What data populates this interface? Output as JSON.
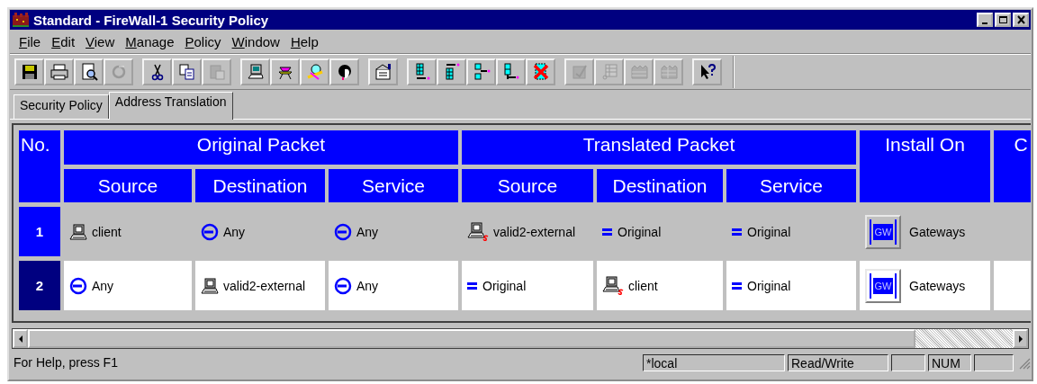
{
  "window": {
    "title": "Standard - FireWall-1 Security Policy"
  },
  "menu": [
    "File",
    "Edit",
    "View",
    "Manage",
    "Policy",
    "Window",
    "Help"
  ],
  "toolbar": [
    {
      "buttons": [
        {
          "disabled": false
        },
        {
          "disabled": false
        },
        {
          "disabled": false
        },
        {
          "disabled": true
        }
      ]
    },
    {
      "buttons": [
        {
          "disabled": false
        },
        {
          "disabled": false
        },
        {
          "disabled": true
        }
      ]
    },
    {
      "buttons": [
        {
          "disabled": false
        },
        {
          "disabled": false
        },
        {
          "disabled": false
        },
        {
          "disabled": false
        }
      ]
    },
    {
      "buttons": [
        {
          "disabled": false
        }
      ]
    },
    {
      "buttons": [
        {
          "disabled": false
        },
        {
          "disabled": false
        },
        {
          "disabled": false
        },
        {
          "disabled": false
        },
        {
          "disabled": false
        }
      ]
    },
    {
      "buttons": [
        {
          "disabled": true
        },
        {
          "disabled": true
        },
        {
          "disabled": true
        },
        {
          "disabled": true
        }
      ]
    },
    {
      "buttons": [
        {
          "disabled": false
        }
      ]
    }
  ],
  "tabs": [
    {
      "label": "Security Policy",
      "selected": false
    },
    {
      "label": "Address Translation",
      "selected": true
    }
  ],
  "table": {
    "headers": [
      {
        "kind": "single",
        "label": "No."
      },
      {
        "kind": "group",
        "label": "Original Packet",
        "columns": [
          "Source",
          "Destination",
          "Service"
        ]
      },
      {
        "kind": "group",
        "label": "Translated Packet",
        "columns": [
          "Source",
          "Destination",
          "Service"
        ]
      },
      {
        "kind": "single",
        "label": "Install On"
      },
      {
        "kind": "single",
        "label": "C"
      }
    ],
    "rows": [
      {
        "number": "1",
        "selected": false,
        "shaded": true,
        "cells": [
          {
            "kind": "host",
            "text": "client"
          },
          {
            "kind": "any",
            "text": "Any"
          },
          {
            "kind": "any",
            "text": "Any"
          },
          {
            "kind": "translated-host",
            "text": "valid2-external"
          },
          {
            "kind": "original",
            "text": "Original"
          },
          {
            "kind": "original",
            "text": "Original"
          },
          {
            "kind": "gateway",
            "badge": "GW",
            "text": "Gateways"
          }
        ]
      },
      {
        "number": "2",
        "selected": true,
        "shaded": false,
        "cells": [
          {
            "kind": "any",
            "text": "Any"
          },
          {
            "kind": "host",
            "text": "valid2-external"
          },
          {
            "kind": "any",
            "text": "Any"
          },
          {
            "kind": "original",
            "text": "Original"
          },
          {
            "kind": "translated-host",
            "text": "client"
          },
          {
            "kind": "original",
            "text": "Original"
          },
          {
            "kind": "gateway",
            "badge": "GW",
            "text": "Gateways"
          }
        ]
      }
    ]
  },
  "status_bar": {
    "message": "For Help, press F1",
    "panes": [
      {
        "kind": "text",
        "text": "*local"
      },
      {
        "kind": "text",
        "text": "Read/Write"
      },
      {
        "kind": "blank"
      },
      {
        "kind": "text",
        "text": "NUM"
      },
      {
        "kind": "blank"
      }
    ]
  }
}
